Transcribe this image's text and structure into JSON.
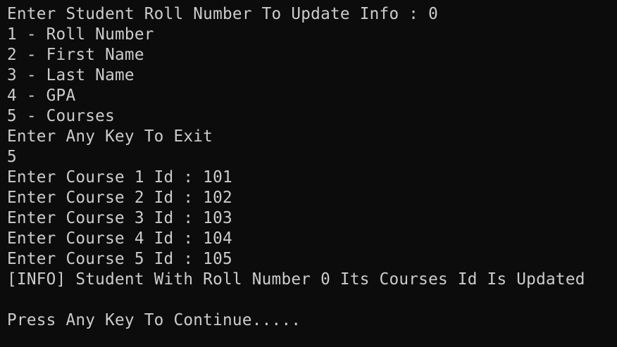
{
  "terminal": {
    "lines": [
      "Enter Student Roll Number To Update Info : 0",
      "1 - Roll Number",
      "2 - First Name",
      "3 - Last Name",
      "4 - GPA",
      "5 - Courses",
      "Enter Any Key To Exit",
      "5",
      "Enter Course 1 Id : 101",
      "Enter Course 2 Id : 102",
      "Enter Course 3 Id : 103",
      "Enter Course 4 Id : 104",
      "Enter Course 5 Id : 105",
      "[INFO] Student With Roll Number 0 Its Courses Id Is Updated",
      "",
      "Press Any Key To Continue....."
    ],
    "colors": {
      "background": "#0c0c0c",
      "foreground": "#cccccc"
    }
  }
}
